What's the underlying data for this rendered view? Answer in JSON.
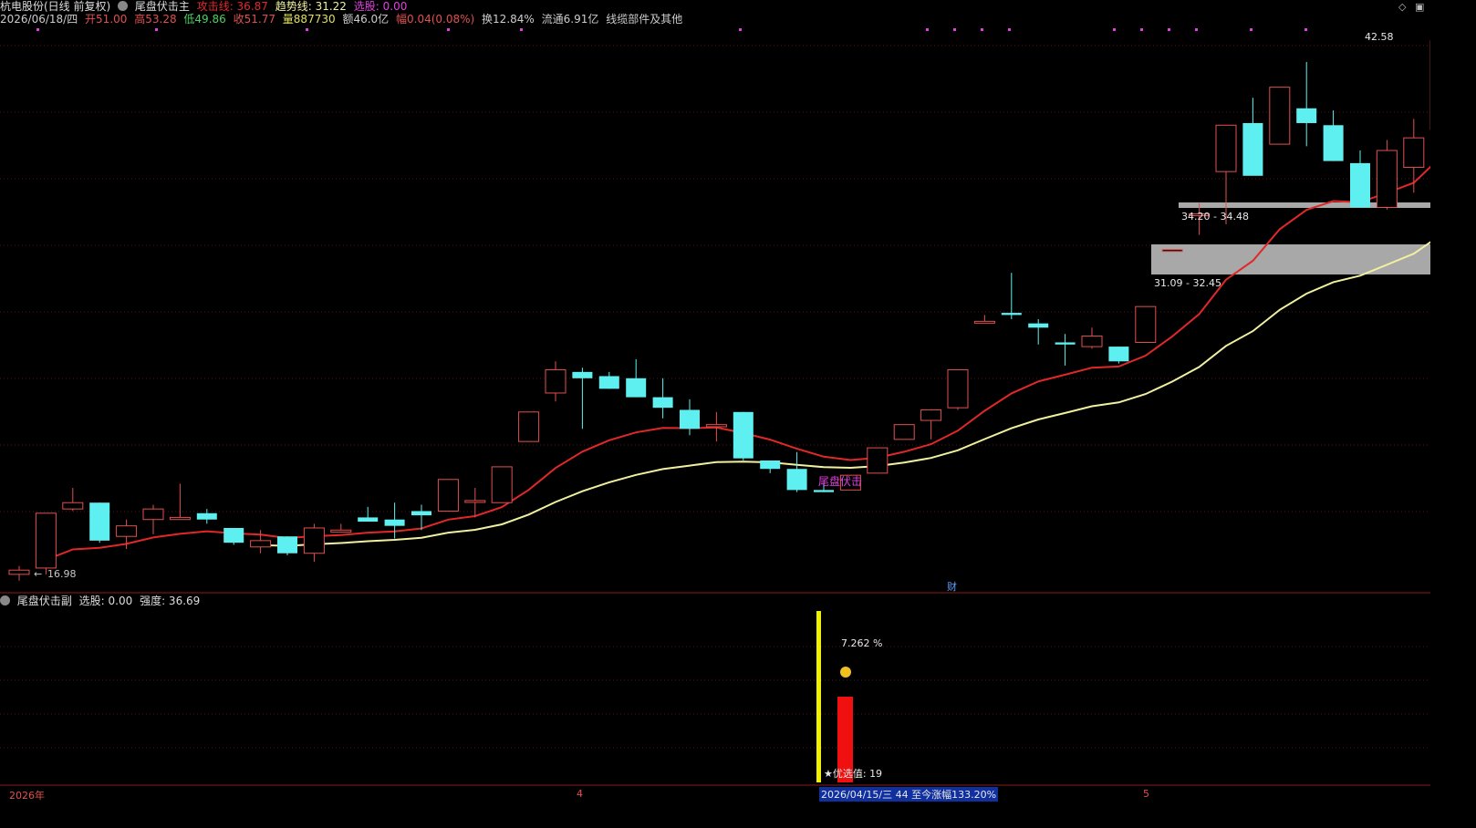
{
  "header": {
    "stock": "杭电股份(日线 前复权)",
    "indicator_main": "尾盘伏击主",
    "attack_label": "攻击线: 36.87",
    "trend_label": "趋势线: 31.22",
    "select_label": "选股: 0.00"
  },
  "quote": {
    "date": "2026/06/18/四",
    "open": "开51.00",
    "high": "高53.28",
    "low": "低49.86",
    "close": "收51.77",
    "volume": "量887730",
    "amount": "额46.0亿",
    "change": "幅0.04(0.08%)",
    "turnover": "换12.84%",
    "float": "流通6.91亿",
    "sector": "线缆部件及其他"
  },
  "sub_header": {
    "indicator_sub": "尾盘伏击副",
    "select": "选股: 0.00",
    "strength": "强度: 36.69"
  },
  "colors": {
    "up": "#e05050",
    "down": "#5ef0f0",
    "attack_line": "#e02828",
    "trend_line": "#f0f0a0",
    "zone": "#a8a8a8",
    "grid": "#5a1414",
    "signal": "#e040e0",
    "yellow": "#f0f000",
    "red_bar": "#f01010"
  },
  "chart_data": [
    {
      "type": "candlestick",
      "title": "尾盘伏击主",
      "series": [
        {
          "name": "K线",
          "ohlc": [
            [
              16.9,
              17.3,
              16.6,
              17.1
            ],
            [
              17.2,
              19.8,
              16.9,
              19.8
            ],
            [
              20.0,
              21.0,
              19.9,
              20.3
            ],
            [
              20.3,
              20.3,
              18.4,
              18.5
            ],
            [
              18.7,
              19.5,
              18.1,
              19.2
            ],
            [
              19.5,
              20.2,
              18.8,
              20.0
            ],
            [
              19.5,
              21.2,
              19.5,
              19.6
            ],
            [
              19.8,
              20.0,
              19.3,
              19.5
            ],
            [
              19.1,
              19.1,
              18.3,
              18.4
            ],
            [
              18.2,
              19.0,
              17.9,
              18.5
            ],
            [
              18.7,
              18.7,
              17.8,
              17.9
            ],
            [
              17.9,
              19.3,
              17.5,
              19.1
            ],
            [
              18.9,
              19.3,
              18.9,
              19.0
            ],
            [
              19.6,
              20.1,
              19.4,
              19.4
            ],
            [
              19.5,
              20.3,
              18.6,
              19.2
            ],
            [
              19.9,
              20.2,
              19.0,
              19.7
            ],
            [
              19.9,
              21.4,
              19.9,
              21.4
            ],
            [
              20.4,
              21.0,
              19.6,
              20.4
            ],
            [
              20.3,
              22.0,
              20.3,
              22.0
            ],
            [
              23.2,
              24.6,
              23.2,
              24.6
            ],
            [
              25.5,
              27.0,
              25.1,
              26.6
            ],
            [
              26.5,
              26.7,
              23.8,
              26.2
            ],
            [
              26.3,
              26.5,
              25.7,
              25.7
            ],
            [
              26.2,
              27.1,
              25.3,
              25.3
            ],
            [
              25.3,
              26.2,
              24.3,
              24.8
            ],
            [
              24.7,
              25.2,
              23.5,
              23.8
            ],
            [
              23.9,
              24.6,
              23.2,
              24.0
            ],
            [
              24.6,
              24.6,
              22.3,
              22.4
            ],
            [
              22.3,
              22.3,
              21.7,
              21.9
            ],
            [
              21.9,
              22.7,
              20.8,
              20.9
            ],
            [
              20.9,
              21.2,
              20.8,
              20.8
            ],
            [
              20.9,
              21.6,
              20.9,
              21.6
            ],
            [
              21.7,
              22.8,
              21.7,
              22.9
            ],
            [
              23.3,
              24.0,
              23.3,
              24.0
            ],
            [
              24.2,
              24.6,
              23.3,
              24.7
            ],
            [
              24.8,
              26.2,
              24.7,
              26.6
            ],
            [
              28.9,
              29.2,
              28.9,
              28.9
            ],
            [
              29.3,
              31.2,
              29.0,
              29.2
            ],
            [
              28.8,
              29.0,
              27.8,
              28.6
            ],
            [
              27.9,
              28.3,
              26.8,
              27.8
            ],
            [
              27.7,
              28.6,
              27.6,
              28.2
            ],
            [
              27.7,
              27.7,
              26.9,
              27.0
            ],
            [
              27.9,
              28.6,
              27.9,
              29.6
            ],
            [
              32.3,
              32.3,
              32.3,
              32.3
            ],
            [
              34.0,
              34.5,
              33.0,
              34.0
            ],
            [
              36.0,
              36.5,
              33.5,
              38.2
            ],
            [
              38.3,
              39.5,
              36.5,
              35.8
            ],
            [
              37.3,
              40.0,
              37.5,
              40.0
            ],
            [
              39.0,
              41.2,
              37.2,
              38.3
            ],
            [
              38.2,
              38.9,
              36.5,
              36.5
            ],
            [
              36.4,
              37.0,
              35.5,
              34.3
            ],
            [
              34.3,
              37.5,
              34.2,
              37.0
            ],
            [
              36.2,
              38.5,
              35.0,
              37.6
            ],
            [
              38.0,
              42.58,
              37.6,
              42.2
            ]
          ]
        }
      ],
      "lines": {
        "attack": {
          "name": "攻击线",
          "value": 36.87
        },
        "trend": {
          "name": "趋势线",
          "value": 31.22
        }
      },
      "annotations": {
        "low_mark": "16.98",
        "high_mark": "42.58",
        "zone_upper": "34.20 - 34.48",
        "zone_lower": "31.09 - 32.45",
        "signal_text": "尾盘伏击",
        "finance_tag": "财"
      }
    },
    {
      "type": "bar",
      "title": "尾盘伏击副",
      "annotations": {
        "pct": "7.262 %",
        "best_value": "★优选值: 19",
        "highlight_date": "2026/04/15/三 44 至今涨幅133.20%"
      }
    }
  ],
  "bottom_axis": {
    "year_label": "2026年",
    "month4": "4",
    "month5": "5"
  }
}
